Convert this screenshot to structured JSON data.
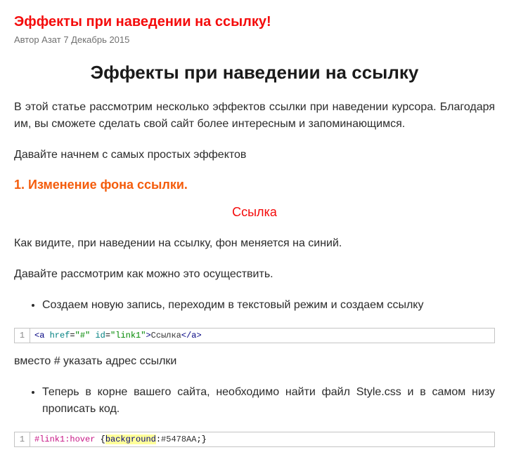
{
  "post": {
    "title_link": "Эффекты при наведении на ссылку!",
    "meta": "Автор Азат 7 Декабрь 2015",
    "heading": "Эффекты при наведении на ссылку",
    "intro": "В этой статье рассмотрим несколько эффектов ссылки при наведении курсора. Благодаря им, вы сможете сделать свой сайт более интересным и запоминающимся.",
    "lead": "Давайте начнем с самых простых эффектов",
    "section1_title": "1. Изменение фона ссылки.",
    "demo_link_text": "Ссылка",
    "p1": "Как видите, при наведении на ссылку, фон меняется на синий.",
    "p2": "Давайте рассмотрим как можно это осуществить.",
    "bullet1": "Создаем новую запись, переходим в текстовый режим и создаем ссылку",
    "note1": "вместо # указать адрес ссылки",
    "bullet2": "Теперь в корне вашего сайта, необходимо найти файл Style.css и в самом низу прописать код."
  },
  "code1": {
    "line_no": "1",
    "raw": "<a href=\"#\" id=\"link1\">Ссылка</a>",
    "tokens": {
      "open_lt": "<",
      "tag_a": "a",
      "attr_href": "href",
      "eq": "=",
      "val_href": "\"#\"",
      "attr_id": "id",
      "val_id": "\"link1\"",
      "gt": ">",
      "text": "Ссылка",
      "close_lt": "</",
      "close_tag": "a",
      "close_gt": ">"
    }
  },
  "code2": {
    "line_no": "1",
    "raw": "#link1:hover {background:#5478AA;}",
    "tokens": {
      "selector": "#link1:hover",
      "sp": " ",
      "lb": "{",
      "prop": "background",
      "colon": ":",
      "val": "#5478AA",
      "semi": ";",
      "rb": "}"
    }
  }
}
